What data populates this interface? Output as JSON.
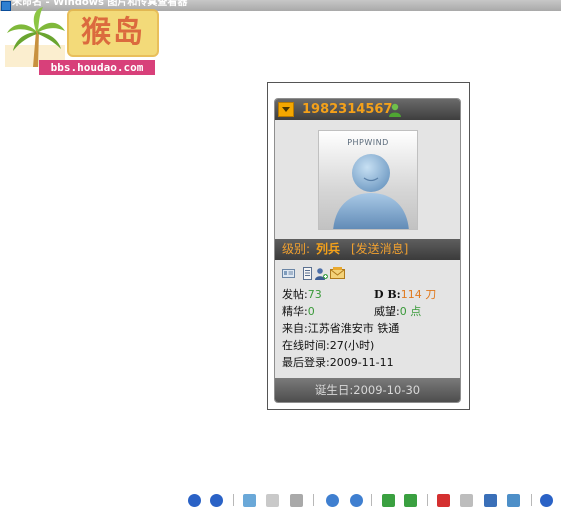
{
  "window": {
    "title": "未命名 - Windows 图片和传真查看器"
  },
  "watermark": {
    "brand": "猴岛",
    "url": "bbs.houdao.com"
  },
  "profile": {
    "user_id": "1982314567",
    "avatar_brand": "PHPWIND",
    "rank_label": "级别:",
    "rank_value": "列兵",
    "send_message": "[发送消息]",
    "posts_label": "发帖:",
    "posts_value": "73",
    "db_label": "D B:",
    "db_value": "114 刀",
    "elite_label": "精华:",
    "elite_value": "0",
    "prestige_label": "威望:",
    "prestige_value": "0 点",
    "from": "来自:江苏省淮安市 铁通",
    "online_time": "在线时间:27(小时)",
    "last_login": "最后登录:2009-11-11",
    "birthday": "诞生日:2009-10-30"
  },
  "icons": {
    "header": [
      "collapse-arrow-icon",
      "online-user-icon"
    ],
    "row": [
      "profile-card-icon",
      "document-icon",
      "add-friend-icon",
      "email-icon"
    ],
    "toolbar": [
      "previous-icon",
      "next-icon",
      "best-fit-icon",
      "actual-size-icon",
      "slideshow-icon",
      "zoom-in-icon",
      "zoom-out-icon",
      "rotate-clockwise-icon",
      "rotate-counterclockwise-icon",
      "delete-icon",
      "print-icon",
      "save-icon",
      "edit-icon",
      "help-icon"
    ]
  },
  "colors": {
    "accent_orange": "#f4a11a",
    "value_green": "#3a9a3a",
    "value_orange": "#e07a20",
    "header_dark": "#3e3e3e"
  }
}
